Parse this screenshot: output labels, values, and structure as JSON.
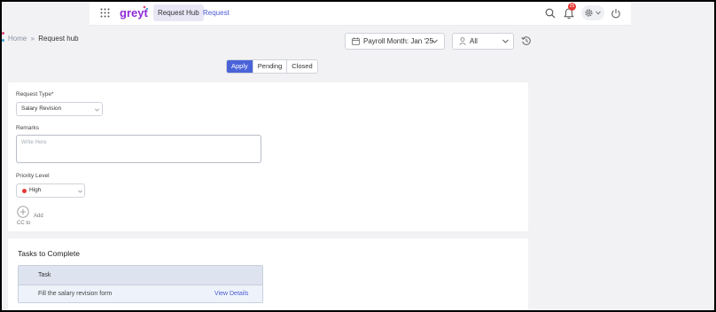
{
  "header": {
    "logo_text": "greyt",
    "tabs": [
      {
        "label": "Request Hub",
        "active": true
      },
      {
        "label": "Request",
        "active": false
      }
    ],
    "notification_count": "25",
    "icons": [
      "apps-grid-icon",
      "search-icon",
      "bell-icon",
      "gear-icon",
      "power-icon"
    ]
  },
  "breadcrumb": {
    "home": "Home",
    "separator": "»",
    "current": "Request hub"
  },
  "filters": {
    "payroll_month": "Payroll Month: Jan '25",
    "scope": "All"
  },
  "segments": {
    "items": [
      "Apply",
      "Pending",
      "Closed"
    ],
    "active": "Apply"
  },
  "form": {
    "request_type_label": "Request Type*",
    "request_type_value": "Salary Revision",
    "remarks_label": "Remarks",
    "remarks_placeholder": "Write Here",
    "priority_label": "Priority Level",
    "priority_value": "High",
    "add_label": "Add",
    "cc_label": "CC to"
  },
  "tasks": {
    "title": "Tasks to Complete",
    "column_header": "Task",
    "rows": [
      {
        "name": "Fill the salary revision form",
        "action": "View Details"
      }
    ]
  },
  "colors": {
    "accent": "#4a63d9",
    "brand": "#8e2bd6",
    "priority_high": "#e53935",
    "badge": "#e53935"
  }
}
